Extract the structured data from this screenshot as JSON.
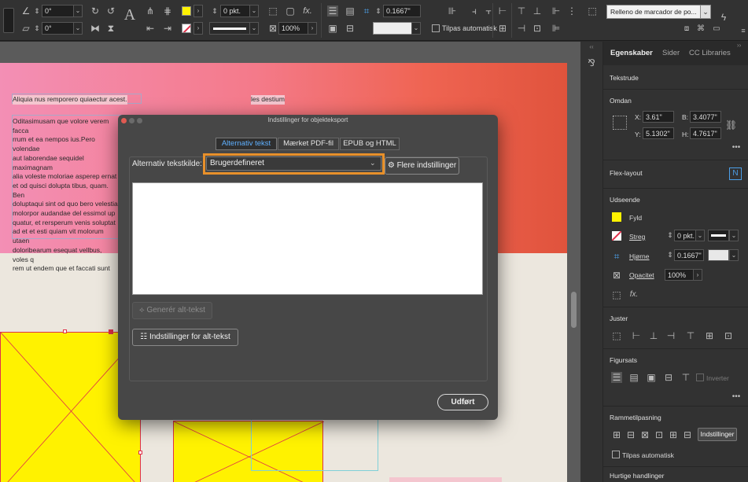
{
  "toolbar": {
    "angle1": "0°",
    "angle2": "0°",
    "stroke_weight": "0 pkt.",
    "zoom": "100%",
    "corner": "0.1667\"",
    "autofit_label": "Tilpas automatisk",
    "object_style": "Relleno de marcador de po..."
  },
  "canvas": {
    "headline": "Aliquia nus remporero quiaectur acest.",
    "right_text": "les destium",
    "body_lines": [
      "Oditasimusam que volore verem facca",
      "rrum et ea nempos ius.Pero volendae",
      "aut laborendae sequidel maximagnam",
      "alia voleste moloriae asperep ernat",
      "et od quisci dolupta tibus, quam. Ben",
      "doluptaqui sint od quo bero velestia",
      "molorpor audandae del essimol up",
      "quatur, et rersperum venis soluptat",
      "ad et et esti quiam vit molorum utaen",
      "doloribearum esequat vellbus, voles q",
      "rem ut endem que et faccati sunt"
    ]
  },
  "dialog": {
    "title": "Indstillinger for objekteksport",
    "tabs": [
      {
        "label": "Alternativ tekst",
        "active": true
      },
      {
        "label": "Mærket PDF-fil",
        "active": false
      },
      {
        "label": "EPUB og HTML",
        "active": false
      }
    ],
    "source_label": "Alternativ tekstkilde:",
    "source_value": "Brugerdefineret",
    "more_settings": "Flere indstillinger",
    "alt_text_value": "",
    "generate_label": "Generér alt-tekst",
    "alt_settings_label": "Indstillinger for alt-tekst",
    "done_label": "Udført"
  },
  "panel": {
    "tabs": [
      "Egenskaber",
      "Sider",
      "CC Libraries"
    ],
    "textframe": "Tekstrude",
    "transform": {
      "title": "Omdan",
      "x_label": "X:",
      "x": "3.61\"",
      "y_label": "Y:",
      "y": "5.1302\"",
      "w_label": "B:",
      "w": "3.4077\"",
      "h_label": "H:",
      "h": "4.7617\""
    },
    "flex_layout": "Flex-layout",
    "appearance": {
      "title": "Udseende",
      "fill": "Fyld",
      "stroke": "Streg",
      "stroke_weight": "0 pkt.",
      "corner": "Hjørne",
      "corner_value": "0.1667\"",
      "opacity": "Opacitet",
      "opacity_value": "100%"
    },
    "align": "Juster",
    "shape": {
      "title": "Figursats",
      "invert": "Inverter"
    },
    "frame_fitting": {
      "title": "Rammetilpasning",
      "settings_button": "Indstillinger",
      "autofit": "Tilpas automatisk"
    },
    "quick_actions": "Hurtige handlinger"
  },
  "colors": {
    "accent_blue": "#5fb0ff",
    "highlight_orange": "#e8902a",
    "fill_yellow": "#fff200",
    "frame_red": "#e0304a"
  }
}
